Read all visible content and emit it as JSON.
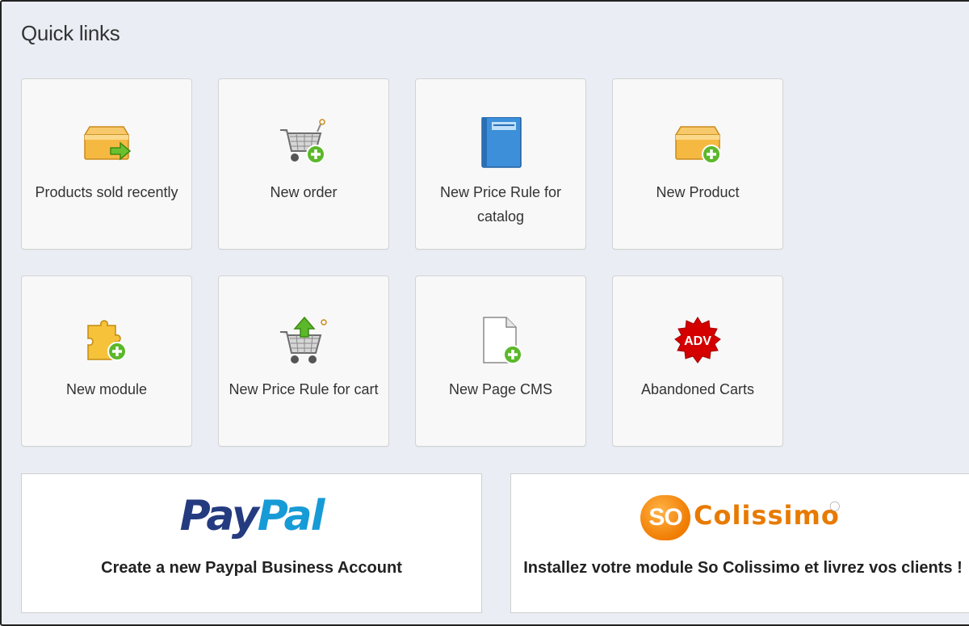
{
  "quick_links": {
    "title": "Quick links",
    "tiles": [
      {
        "label": "Products sold recently",
        "icon": "box-arrow-icon"
      },
      {
        "label": "New order",
        "icon": "cart-add-icon"
      },
      {
        "label": "New Price Rule for catalog",
        "icon": "catalog-book-icon"
      },
      {
        "label": "New Product",
        "icon": "box-add-icon"
      },
      {
        "label": "New module",
        "icon": "puzzle-add-icon"
      },
      {
        "label": "New Price Rule for cart",
        "icon": "cart-up-icon"
      },
      {
        "label": "New Page CMS",
        "icon": "page-add-icon"
      },
      {
        "label": "Abandoned Carts",
        "icon": "adv-badge-icon",
        "badge_text": "ADV"
      }
    ],
    "banners": [
      {
        "logo_part1": "Pay",
        "logo_part2": "Pal",
        "label": "Create a new Paypal Business Account"
      },
      {
        "logo_badge": "SO",
        "logo_word": "Colissimo",
        "label": "Installez votre module So Colissimo et livrez vos clients !"
      }
    ]
  },
  "colors": {
    "panel_bg": "#eaeef4",
    "tile_bg": "#f8f8f8",
    "paypal_dark": "#253b80",
    "paypal_light": "#179bd7",
    "colissimo_orange": "#e87a00",
    "adv_red": "#d40000",
    "green_plus": "#4caf26"
  }
}
